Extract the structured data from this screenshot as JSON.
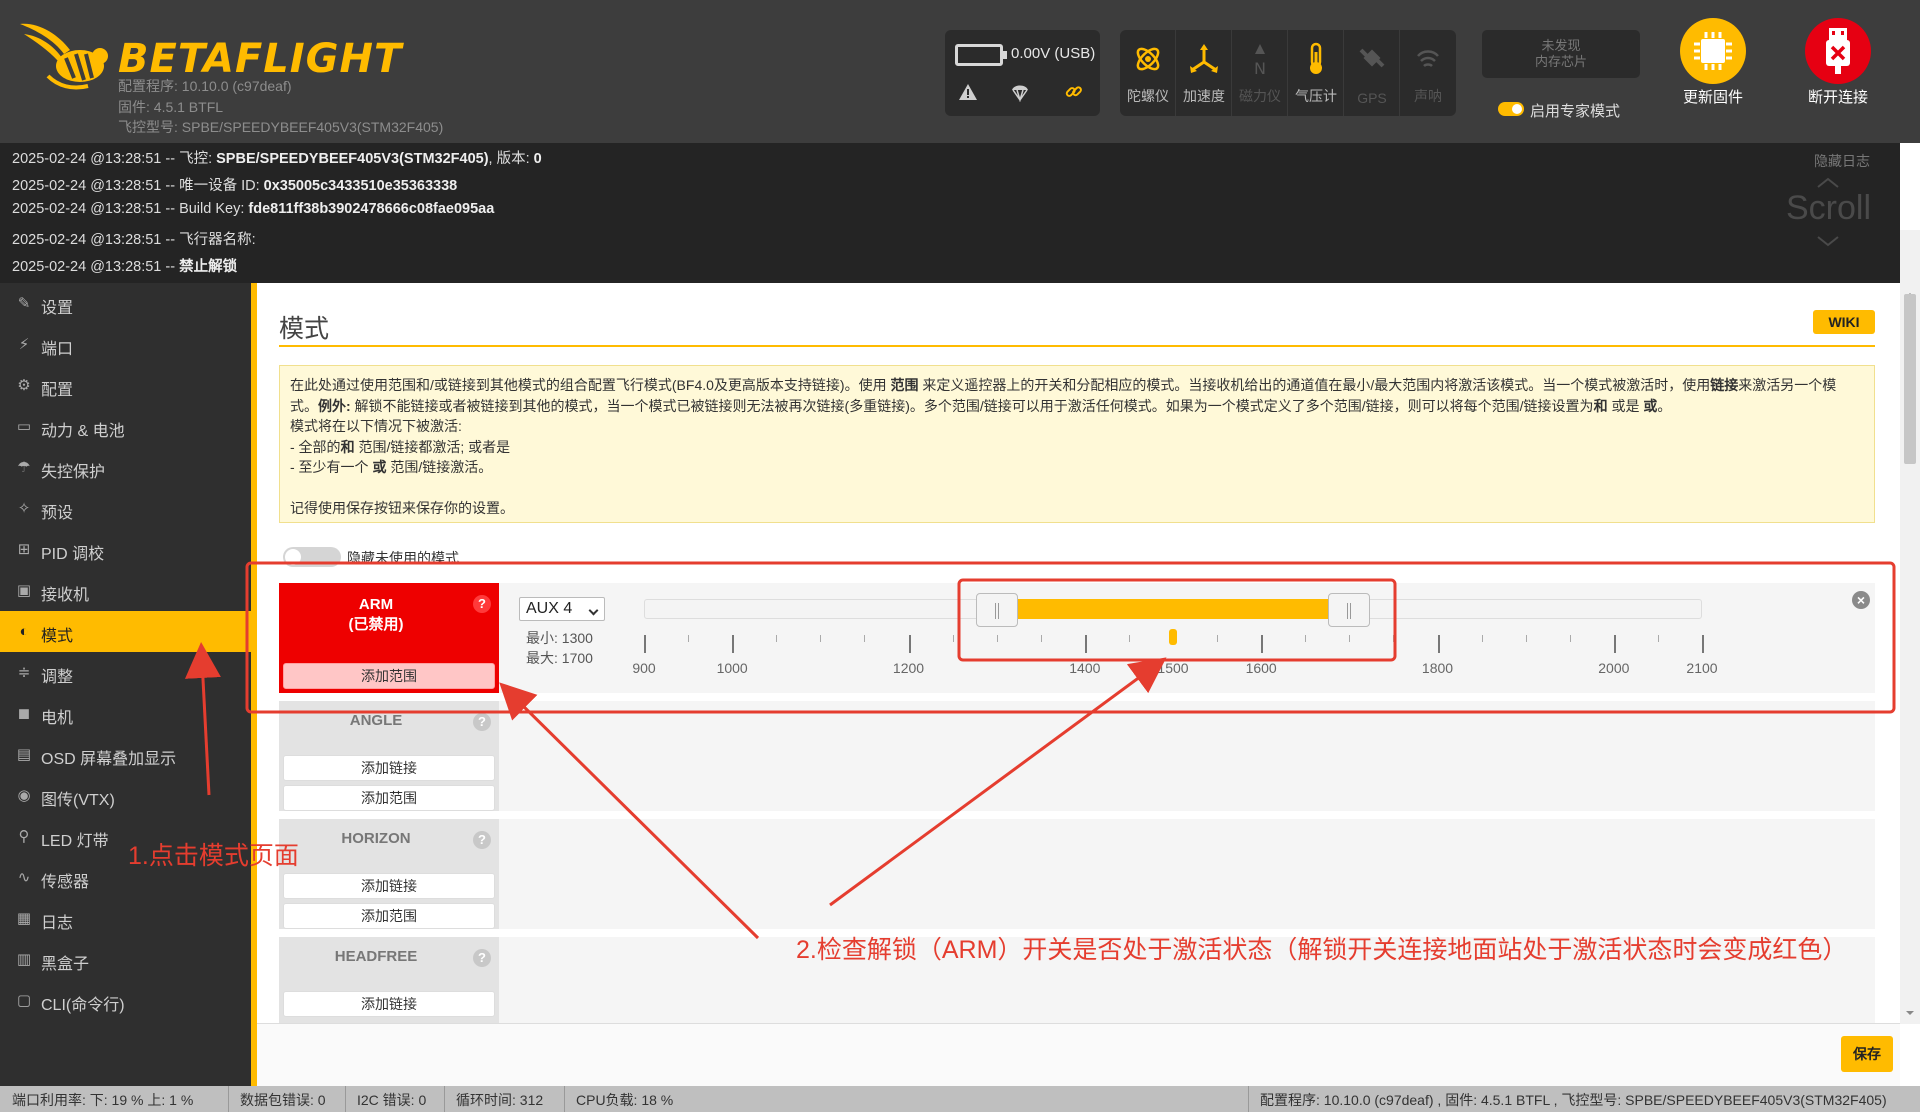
{
  "header": {
    "brand": "BETAFLIGHT",
    "configurator": "配置程序: 10.10.0 (c97deaf)",
    "firmware": "固件: 4.5.1 BTFL",
    "board": "飞控型号: SPBE/SPEEDYBEEF405V3(STM32F405)",
    "battery": "0.00V (USB)",
    "sensors": [
      {
        "label": "陀螺仪",
        "icon": "gyro-icon",
        "active": true
      },
      {
        "label": "加速度",
        "icon": "accel-icon",
        "active": true
      },
      {
        "label": "磁力仪",
        "icon": "compass-icon",
        "active": false
      },
      {
        "label": "气压计",
        "icon": "barometer-icon",
        "active": true
      },
      {
        "label": "GPS",
        "icon": "gps-icon",
        "active": false
      },
      {
        "label": "声呐",
        "icon": "sonar-icon",
        "active": false
      }
    ],
    "flash_line1": "未发现",
    "flash_line2": "内存芯片",
    "expert_mode": "启用专家模式",
    "update_firmware": "更新固件",
    "disconnect": "断开连接",
    "colors": {
      "accent": "#ffbb00",
      "disconnect": "#e60012"
    }
  },
  "log": {
    "hide": "隐藏日志",
    "scroll": "Scroll",
    "lines": [
      {
        "prefix": "2025-02-24 @13:28:51 -- 飞控: ",
        "bold": "SPBE/SPEEDYBEEF405V3(STM32F405)",
        "mid": ", 版本: ",
        "bold2": "0"
      },
      {
        "prefix": "2025-02-24 @13:28:51 -- 唯一设备 ID: ",
        "bold": "0x35005c3433510e35363338",
        "mid": "",
        "bold2": ""
      },
      {
        "prefix": "2025-02-24 @13:28:51 -- Build Key: ",
        "bold": "fde811ff38b3902478666c08fae095aa",
        "mid": "",
        "bold2": ""
      },
      {
        "prefix": "2025-02-24 @13:28:51 -- 飞行器名称:",
        "bold": "",
        "mid": "",
        "bold2": ""
      },
      {
        "prefix": "2025-02-24 @13:28:51 -- ",
        "bold": "禁止解锁",
        "mid": "",
        "bold2": ""
      }
    ]
  },
  "sidebar": {
    "items": [
      {
        "label": "设置",
        "icon": "wrench-icon",
        "active": false
      },
      {
        "label": "端口",
        "icon": "plug-icon",
        "active": false
      },
      {
        "label": "配置",
        "icon": "gear-icon",
        "active": false
      },
      {
        "label": "动力 & 电池",
        "icon": "battery-icon",
        "active": false
      },
      {
        "label": "失控保护",
        "icon": "parachute-icon",
        "active": false
      },
      {
        "label": "预设",
        "icon": "wand-icon",
        "active": false
      },
      {
        "label": "PID 调校",
        "icon": "pid-icon",
        "active": false
      },
      {
        "label": "接收机",
        "icon": "receiver-icon",
        "active": false
      },
      {
        "label": "模式",
        "icon": "toggle-icon",
        "active": true
      },
      {
        "label": "调整",
        "icon": "sliders-icon",
        "active": false
      },
      {
        "label": "电机",
        "icon": "motor-icon",
        "active": false
      },
      {
        "label": "OSD 屏幕叠加显示",
        "icon": "osd-icon",
        "active": false
      },
      {
        "label": "图传(VTX)",
        "icon": "vtx-icon",
        "active": false
      },
      {
        "label": "LED 灯带",
        "icon": "led-icon",
        "active": false
      },
      {
        "label": "传感器",
        "icon": "sensor-icon",
        "active": false
      },
      {
        "label": "日志",
        "icon": "log-icon",
        "active": false
      },
      {
        "label": "黑盒子",
        "icon": "blackbox-icon",
        "active": false
      },
      {
        "label": "CLI(命令行)",
        "icon": "cli-icon",
        "active": false
      }
    ]
  },
  "main": {
    "title": "模式",
    "wiki": "WIKI",
    "note": {
      "p1a": "在此处通过使用范围和/或链接到其他模式的组合配置飞行模式(BF4.0及更高版本支持链接)。使用 ",
      "p1b": "范围",
      "p1c": " 来定义遥控器上的开关和分配相应的模式。当接收机给出的通道值在最小/最大范围内将激活该模式。当一个模式被激活时，使用",
      "p1d": "链接",
      "p1e": "来激活另一个模式。",
      "p1f": "例外:",
      "p1g": " 解锁不能链接或者被链接到其他的模式，当一个模式已被链接则无法被再次链接(多重链接)。多个范围/链接可以用于激活任何模式。如果为一个模式定义了多个范围/链接，则可以将每个范围/链接设置为",
      "p1h": "和",
      "p1i": " 或是 ",
      "p1j": "或",
      "p1k": "。",
      "p2": "模式将在以下情况下被激活:",
      "p3a": "- 全部的",
      "p3b": "和",
      "p3c": " 范围/链接都激活; 或者是",
      "p4a": "- 至少有一个 ",
      "p4b": "或",
      "p4c": " 范围/链接激活。",
      "p5": "记得使用保存按钮来保存你的设置。"
    },
    "hide_unused": "隐藏未使用的模式",
    "arm": {
      "name": "ARM",
      "status": "(已禁用)",
      "add_range": "添加范围",
      "channel": "AUX 4",
      "min_label": "最小: 1300",
      "max_label": "最大: 1700",
      "range_min": 1300,
      "range_max": 1700,
      "current": 1500,
      "scale_min": 900,
      "scale_max": 2100,
      "ticks": [
        "900",
        "1000",
        "1200",
        "1400",
        "1500",
        "1600",
        "1800",
        "2000",
        "2100"
      ]
    },
    "modes": [
      {
        "name": "ANGLE",
        "add_link": "添加链接",
        "add_range": "添加范围"
      },
      {
        "name": "HORIZON",
        "add_link": "添加链接",
        "add_range": "添加范围"
      },
      {
        "name": "HEADFREE",
        "add_link": "添加链接"
      }
    ],
    "save": "保存"
  },
  "annotations": {
    "step1": "1.点击模式页面",
    "step2": "2.检查解锁（ARM）开关是否处于激活状态（解锁开关连接地面站处于激活状态时会变成红色）",
    "color": "#e53d2f"
  },
  "status_bar": {
    "port_util": "端口利用率:   下: 19 %  上: 1 %",
    "packet_errors": "数据包错误: 0",
    "i2c_errors": "I2C 错误: 0",
    "cycle_time": "循环时间: 312",
    "cpu_load": "CPU负载: 18 %",
    "version": "配置程序: 10.10.0 (c97deaf) , 固件: 4.5.1 BTFL , 飞控型号: SPBE/SPEEDYBEEF405V3(STM32F405)"
  }
}
